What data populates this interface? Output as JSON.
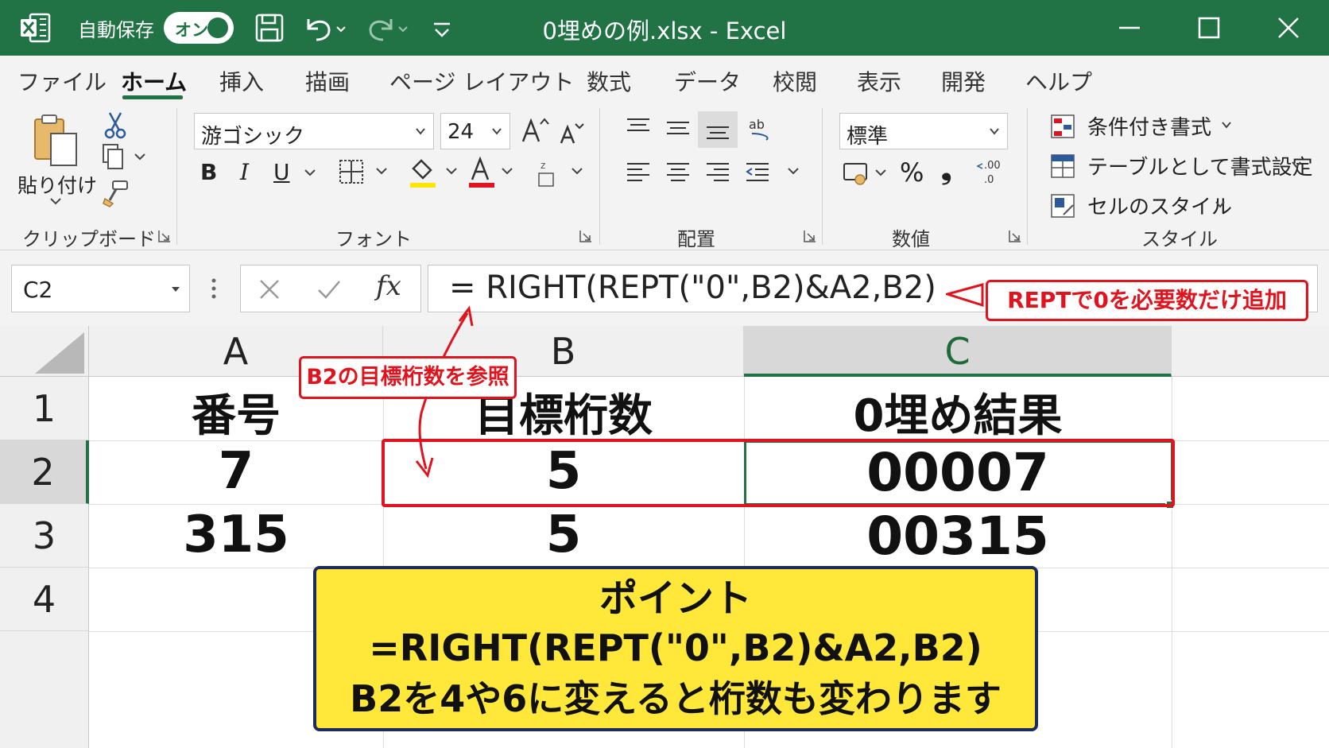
{
  "titlebar": {
    "autosave_label": "自動保存",
    "toggle_label": "オン",
    "title": "0埋めの例.xlsx  -  Excel"
  },
  "tabs": [
    {
      "label": "ファイル"
    },
    {
      "label": "ホーム"
    },
    {
      "label": "挿入"
    },
    {
      "label": "描画"
    },
    {
      "label": "ページ レイアウト"
    },
    {
      "label": "数式"
    },
    {
      "label": "データ"
    },
    {
      "label": "校閲"
    },
    {
      "label": "表示"
    },
    {
      "label": "開発"
    },
    {
      "label": "ヘルプ"
    }
  ],
  "ribbon": {
    "clipboard": {
      "paste_label": "貼り付け",
      "group_label": "クリップボード"
    },
    "font": {
      "font_name": "游ゴシック",
      "font_size": "24",
      "bold": "B",
      "italic": "I",
      "underline": "U",
      "group_label": "フォント"
    },
    "alignment": {
      "group_label": "配置"
    },
    "number": {
      "format": "標準",
      "percent": "%",
      "comma": "❟",
      "group_label": "数値"
    },
    "styles": {
      "conditional": "条件付き書式",
      "table": "テーブルとして書式設定",
      "cell_styles": "セルのスタイル",
      "group_label": "スタイル"
    }
  },
  "formula_bar": {
    "name_box": "C2",
    "fx": "fx",
    "formula": "= RIGHT(REPT(\"0\",B2)&A2,B2)"
  },
  "sheet": {
    "columns": [
      "A",
      "B",
      "C"
    ],
    "rows": [
      "1",
      "2",
      "3",
      "4"
    ],
    "cells": [
      [
        "番号",
        "目標桁数",
        "0埋め結果"
      ],
      [
        "7",
        "5",
        "00007"
      ],
      [
        "315",
        "5",
        "00315"
      ],
      [
        "",
        "",
        ""
      ]
    ],
    "selected_cell": "C2"
  },
  "annotations": {
    "rept_callout": "REPTで0を必要数だけ追加",
    "b2_callout": "B2の目標桁数を参照",
    "point_title": "ポイント",
    "point_formula": "=RIGHT(REPT(\"0\",B2)&A2,B2)",
    "point_note": "B2を4や6に変えると桁数も変わります"
  },
  "colors": {
    "excel_green": "#217346",
    "callout_red": "#e0141e",
    "point_yellow": "#ffe83a",
    "point_border": "#1d2b5e"
  }
}
